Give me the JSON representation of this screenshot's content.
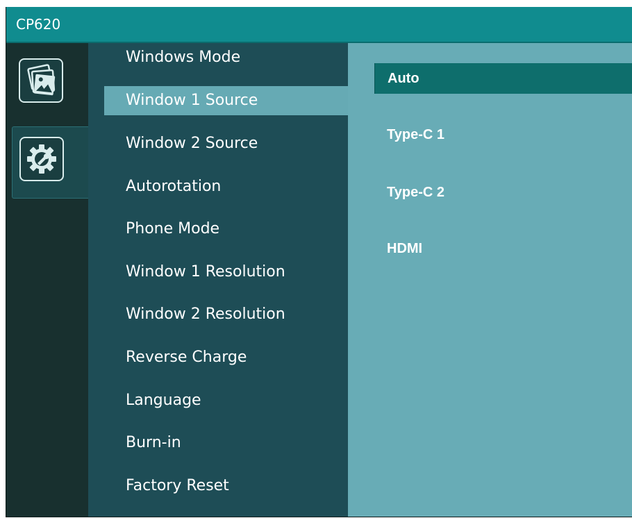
{
  "window": {
    "title": "CP620"
  },
  "rail": {
    "tabs": [
      {
        "icon": "picture-icon",
        "active": false
      },
      {
        "icon": "gear-wrench-icon",
        "active": true
      }
    ]
  },
  "menu": {
    "items": [
      {
        "label": "Windows Mode",
        "selected": false
      },
      {
        "label": "Window 1 Source",
        "selected": true
      },
      {
        "label": "Window 2 Source",
        "selected": false
      },
      {
        "label": "Autorotation",
        "selected": false
      },
      {
        "label": "Phone Mode",
        "selected": false
      },
      {
        "label": "Window 1 Resolution",
        "selected": false
      },
      {
        "label": "Window 2 Resolution",
        "selected": false
      },
      {
        "label": "Reverse Charge",
        "selected": false
      },
      {
        "label": "Language",
        "selected": false
      },
      {
        "label": "Burn-in",
        "selected": false
      },
      {
        "label": "Factory Reset",
        "selected": false
      }
    ]
  },
  "options": {
    "items": [
      {
        "label": "Auto",
        "selected": true
      },
      {
        "label": "Type-C 1",
        "selected": false
      },
      {
        "label": "Type-C 2",
        "selected": false
      },
      {
        "label": "HDMI",
        "selected": false
      }
    ]
  },
  "colors": {
    "title_bar": "#108c8f",
    "menu_bg": "#1e4d56",
    "menu_selected": "#66aab4",
    "options_bg": "#68acb6",
    "option_selected": "#0e6e6c",
    "rail_bg": "#18302f"
  }
}
